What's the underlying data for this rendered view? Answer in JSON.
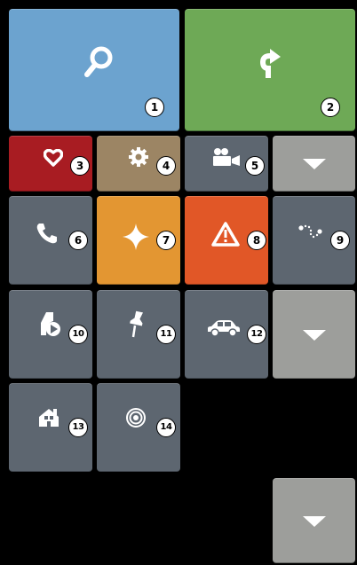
{
  "colors": {
    "search": "#6ca3cf",
    "route": "#6ea956",
    "favorites": "#a81c22",
    "settings": "#9c8564",
    "slate": "#5d6670",
    "gray": "#9d9e9b",
    "orange": "#e39632",
    "alert": "#e15727",
    "background": "#000000"
  },
  "tiles": {
    "search": {
      "badge": "1",
      "icon": "search-icon"
    },
    "route": {
      "badge": "2",
      "icon": "route-arrow-icon"
    },
    "favorites": {
      "badge": "3",
      "icon": "heart-icon"
    },
    "settings": {
      "badge": "4",
      "icon": "gear-icon"
    },
    "video": {
      "badge": "5",
      "icon": "video-camera-icon"
    },
    "phone": {
      "badge": "6",
      "icon": "phone-icon"
    },
    "sparkle": {
      "badge": "7",
      "icon": "sparkle-icon"
    },
    "warning": {
      "badge": "8",
      "icon": "warning-icon"
    },
    "trip": {
      "badge": "9",
      "icon": "dotted-route-icon"
    },
    "navplay": {
      "badge": "10",
      "icon": "pin-play-icon"
    },
    "pin": {
      "badge": "11",
      "icon": "pushpin-icon"
    },
    "car": {
      "badge": "12",
      "icon": "car-icon"
    },
    "home": {
      "badge": "13",
      "icon": "home-icon"
    },
    "signal": {
      "badge": "14",
      "icon": "signal-icon"
    }
  },
  "expanders": [
    {
      "icon": "chevron-down-icon"
    },
    {
      "icon": "chevron-down-icon"
    },
    {
      "icon": "chevron-down-icon"
    }
  ]
}
